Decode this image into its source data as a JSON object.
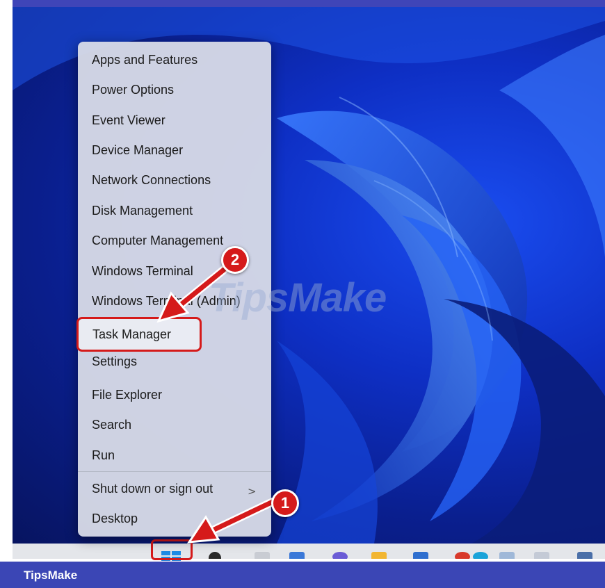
{
  "menu": {
    "items": [
      {
        "label": "Apps and Features"
      },
      {
        "label": "Power Options"
      },
      {
        "label": "Event Viewer"
      },
      {
        "label": "Device Manager"
      },
      {
        "label": "Network Connections"
      },
      {
        "label": "Disk Management"
      },
      {
        "label": "Computer Management"
      },
      {
        "label": "Windows Terminal"
      },
      {
        "label": "Windows Terminal (Admin)"
      },
      {
        "label": "Task Manager"
      },
      {
        "label": "Settings"
      },
      {
        "label": "File Explorer"
      },
      {
        "label": "Search"
      },
      {
        "label": "Run"
      },
      {
        "label": "Shut down or sign out"
      },
      {
        "label": "Desktop"
      }
    ],
    "chevron": ">"
  },
  "annotations": {
    "step1": "1",
    "step2": "2",
    "accent_color": "#d51a1a"
  },
  "watermark": "TipsMake",
  "footer": {
    "brand": "TipsMake",
    "color": "#3b46b5"
  },
  "taskbar": {
    "icons": [
      "start-icon",
      "search-icon",
      "task-view-icon",
      "widgets-icon",
      "chat-icon",
      "file-explorer-icon",
      "store-icon",
      "chrome-icon",
      "edge-icon",
      "app-icon",
      "app-icon",
      "app-icon"
    ]
  }
}
